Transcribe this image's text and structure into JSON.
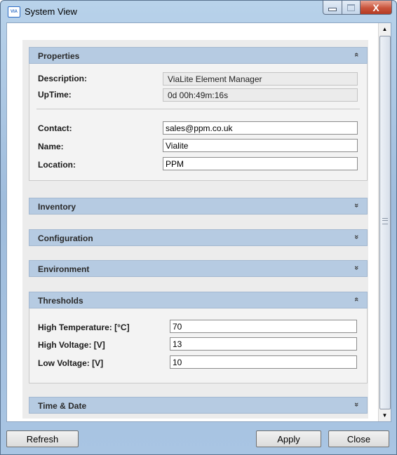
{
  "window": {
    "title": "System View",
    "icon": "vialite-app-icon"
  },
  "sections": {
    "properties": {
      "title": "Properties",
      "expanded": true,
      "description_label": "Description:",
      "description_value": "ViaLite Element Manager",
      "uptime_label": "UpTime:",
      "uptime_value": "0d 00h:49m:16s",
      "contact_label": "Contact:",
      "contact_value": "sales@ppm.co.uk",
      "name_label": "Name:",
      "name_value": "Vialite",
      "location_label": "Location:",
      "location_value": "PPM"
    },
    "inventory": {
      "title": "Inventory",
      "expanded": false
    },
    "configuration": {
      "title": "Configuration",
      "expanded": false
    },
    "environment": {
      "title": "Environment",
      "expanded": false
    },
    "thresholds": {
      "title": "Thresholds",
      "expanded": true,
      "high_temp_label": "High Temperature: [°C]",
      "high_temp_value": "70",
      "high_voltage_label": "High Voltage: [V]",
      "high_voltage_value": "13",
      "low_voltage_label": "Low Voltage: [V]",
      "low_voltage_value": "10"
    },
    "time_date": {
      "title": "Time & Date",
      "expanded": false
    }
  },
  "glyphs": {
    "collapse": "«",
    "expand": "»",
    "close": "X"
  },
  "buttons": {
    "refresh": "Refresh",
    "apply": "Apply",
    "close": "Close"
  }
}
